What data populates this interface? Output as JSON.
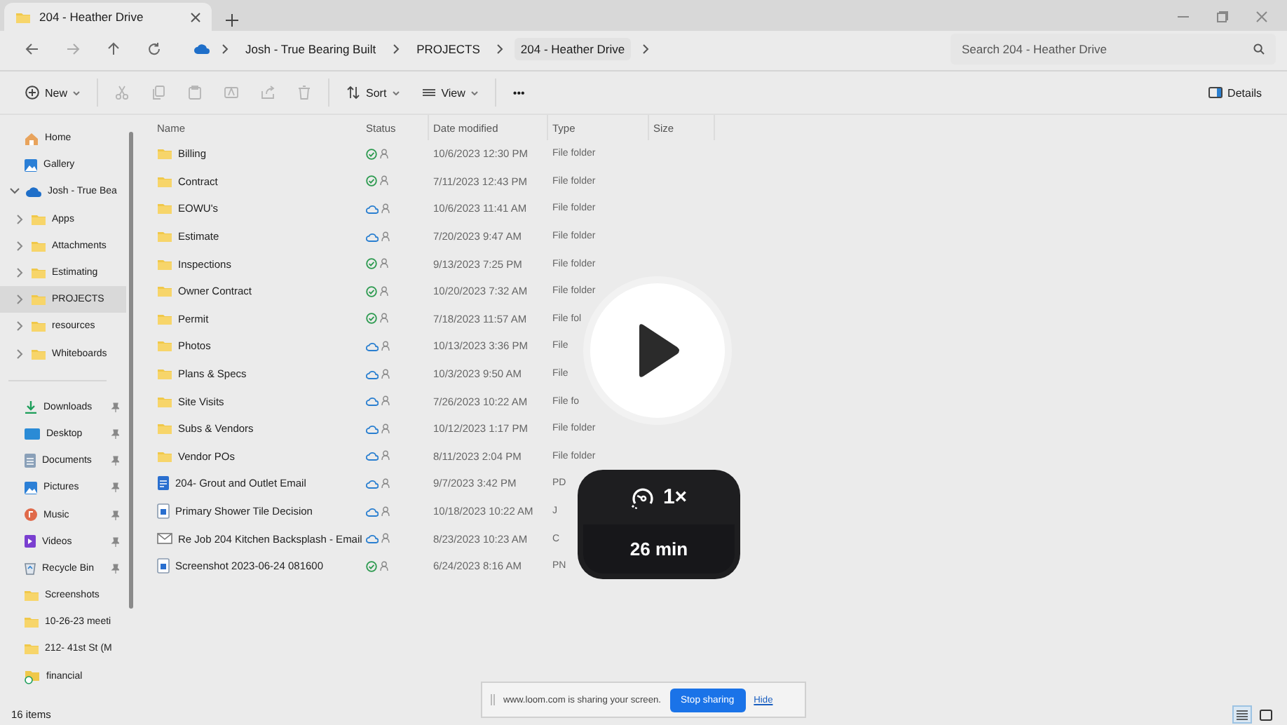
{
  "window": {
    "tab_title": "204 - Heather Drive"
  },
  "address_bar": {
    "breadcrumbs": [
      "Josh - True Bearing Built",
      "PROJECTS",
      "204 - Heather Drive"
    ],
    "search_placeholder": "Search 204 - Heather Drive"
  },
  "toolbar": {
    "new_label": "New",
    "sort_label": "Sort",
    "view_label": "View",
    "more_label": "•••",
    "details_label": "Details"
  },
  "sidebar": {
    "tree": [
      {
        "label": "Home",
        "kind": "home"
      },
      {
        "label": "Gallery",
        "kind": "gallery"
      },
      {
        "label": "Josh - True Bea",
        "kind": "cloud",
        "expanded": true,
        "children": [
          {
            "label": "Apps",
            "kind": "folder",
            "expanded": false,
            "selected": false
          },
          {
            "label": "Attachments",
            "kind": "folder",
            "expanded": false,
            "selected": false
          },
          {
            "label": "Estimating",
            "kind": "folder",
            "expanded": false,
            "selected": false
          },
          {
            "label": "PROJECTS",
            "kind": "folder",
            "expanded": false,
            "selected": true
          },
          {
            "label": "resources",
            "kind": "folder",
            "expanded": false,
            "selected": false
          },
          {
            "label": "Whiteboards",
            "kind": "folder",
            "expanded": false,
            "selected": false
          }
        ]
      }
    ],
    "quick_access": [
      {
        "label": "Downloads",
        "kind": "downloads",
        "pinned": true
      },
      {
        "label": "Desktop",
        "kind": "desktop",
        "pinned": true
      },
      {
        "label": "Documents",
        "kind": "documents",
        "pinned": true
      },
      {
        "label": "Pictures",
        "kind": "pictures",
        "pinned": true
      },
      {
        "label": "Music",
        "kind": "music",
        "pinned": true
      },
      {
        "label": "Videos",
        "kind": "videos",
        "pinned": true
      },
      {
        "label": "Recycle Bin",
        "kind": "recycle",
        "pinned": true
      },
      {
        "label": "Screenshots",
        "kind": "folder",
        "pinned": false
      },
      {
        "label": "10-26-23 meeti",
        "kind": "folder",
        "pinned": false
      },
      {
        "label": "212- 41st St (M",
        "kind": "folder",
        "pinned": false
      },
      {
        "label": "financial",
        "kind": "synced-folder",
        "pinned": false
      }
    ]
  },
  "table": {
    "columns": [
      "Name",
      "Status",
      "Date modified",
      "Type",
      "Size"
    ],
    "rows": [
      {
        "name": "Billing",
        "kind": "folder",
        "synced": true,
        "date": "10/6/2023 12:30 PM",
        "type": "File folder"
      },
      {
        "name": "Contract",
        "kind": "folder",
        "synced": true,
        "date": "7/11/2023 12:43 PM",
        "type": "File folder"
      },
      {
        "name": "EOWU's",
        "kind": "folder",
        "synced": false,
        "date": "10/6/2023 11:41 AM",
        "type": "File folder"
      },
      {
        "name": "Estimate",
        "kind": "folder",
        "synced": false,
        "date": "7/20/2023 9:47 AM",
        "type": "File folder"
      },
      {
        "name": "Inspections",
        "kind": "folder",
        "synced": true,
        "date": "9/13/2023 7:25 PM",
        "type": "File folder"
      },
      {
        "name": "Owner Contract",
        "kind": "folder",
        "synced": true,
        "date": "10/20/2023 7:32 AM",
        "type": "File folder"
      },
      {
        "name": "Permit",
        "kind": "folder",
        "synced": true,
        "date": "7/18/2023 11:57 AM",
        "type": "File fol"
      },
      {
        "name": "Photos",
        "kind": "folder",
        "synced": false,
        "date": "10/13/2023 3:36 PM",
        "type": "File"
      },
      {
        "name": "Plans & Specs",
        "kind": "folder",
        "synced": false,
        "date": "10/3/2023 9:50 AM",
        "type": "File"
      },
      {
        "name": "Site Visits",
        "kind": "folder",
        "synced": false,
        "date": "7/26/2023 10:22 AM",
        "type": "File fo"
      },
      {
        "name": "Subs & Vendors",
        "kind": "folder",
        "synced": false,
        "date": "10/12/2023 1:17 PM",
        "type": "File folder"
      },
      {
        "name": "Vendor POs",
        "kind": "folder",
        "synced": false,
        "date": "8/11/2023 2:04 PM",
        "type": "File folder"
      },
      {
        "name": "204- Grout and Outlet Email",
        "kind": "pdf",
        "synced": false,
        "date": "9/7/2023 3:42 PM",
        "type": "PD"
      },
      {
        "name": "Primary Shower Tile Decision",
        "kind": "image",
        "synced": false,
        "date": "10/18/2023 10:22 AM",
        "type": "J"
      },
      {
        "name": "Re Job 204 Kitchen Backsplash - Email",
        "kind": "email",
        "synced": false,
        "date": "8/23/2023 10:23 AM",
        "type": "C"
      },
      {
        "name": "Screenshot 2023-06-24 081600",
        "kind": "image",
        "synced": true,
        "date": "6/24/2023 8:16 AM",
        "type": "PN"
      }
    ]
  },
  "status_bar": {
    "item_count": "16 items",
    "view_modes": [
      {
        "kind": "details",
        "selected": true
      },
      {
        "kind": "tiles",
        "selected": false
      }
    ]
  },
  "player": {
    "speed": "1×",
    "duration": "26 min"
  },
  "share_bar": {
    "message": "www.loom.com is sharing your screen.",
    "stop_label": "Stop sharing",
    "hide_label": "Hide"
  }
}
